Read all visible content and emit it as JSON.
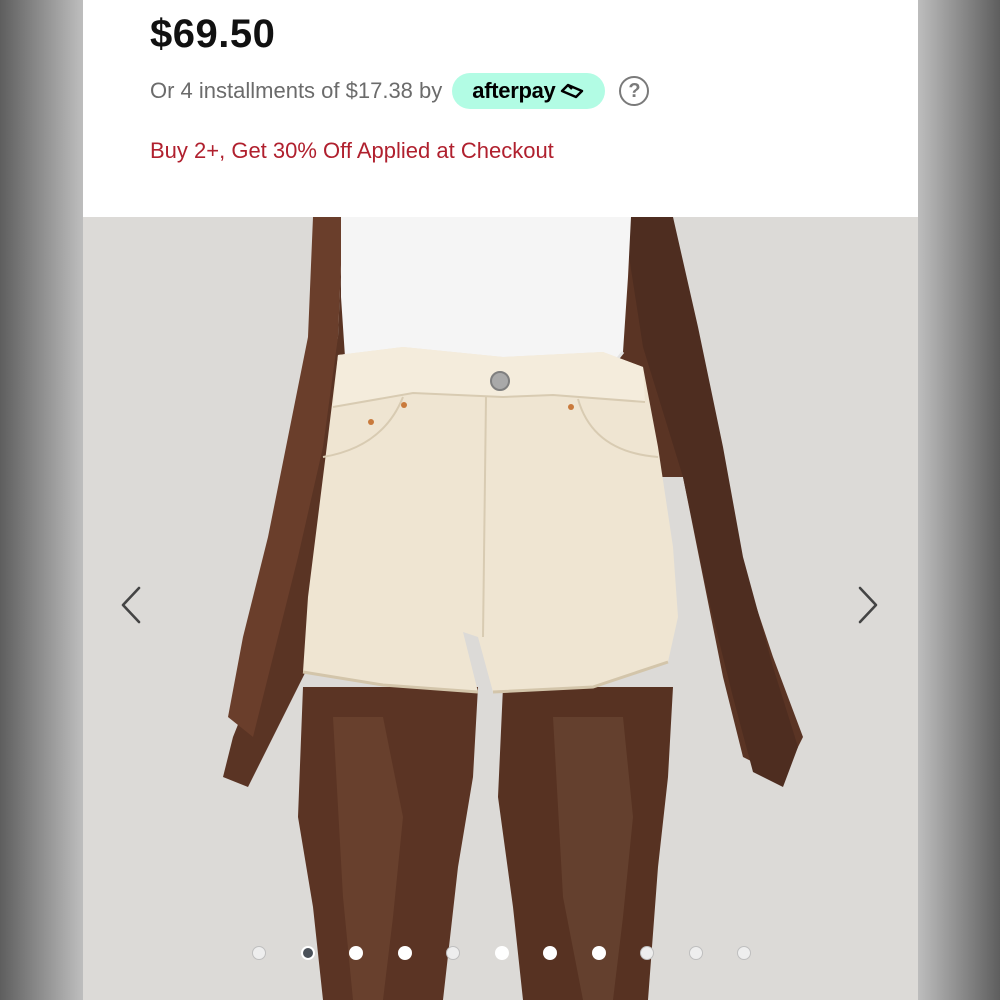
{
  "product": {
    "price": "$69.50",
    "installments_text": "Or 4 installments of $17.38 by",
    "afterpay_label": "afterpay",
    "promo_text": "Buy 2+, Get 30% Off Applied at Checkout"
  },
  "gallery": {
    "image_description": "Model wearing cream high-rise denim shorts with white tank top",
    "slide_count": 11,
    "active_slide": 2,
    "slides": [
      {
        "state": "dim"
      },
      {
        "state": "active"
      },
      {
        "state": "normal"
      },
      {
        "state": "normal"
      },
      {
        "state": "dim"
      },
      {
        "state": "normal"
      },
      {
        "state": "normal"
      },
      {
        "state": "normal"
      },
      {
        "state": "dim"
      },
      {
        "state": "dim"
      },
      {
        "state": "dim"
      }
    ]
  },
  "icons": {
    "help": "question-circle-icon",
    "prev": "chevron-left-icon",
    "next": "chevron-right-icon",
    "afterpay": "afterpay-arrows-icon"
  },
  "colors": {
    "promo": "#b0202e",
    "afterpay_badge": "#b2fce4",
    "price": "#111111",
    "active_dot": "#4a5058"
  }
}
